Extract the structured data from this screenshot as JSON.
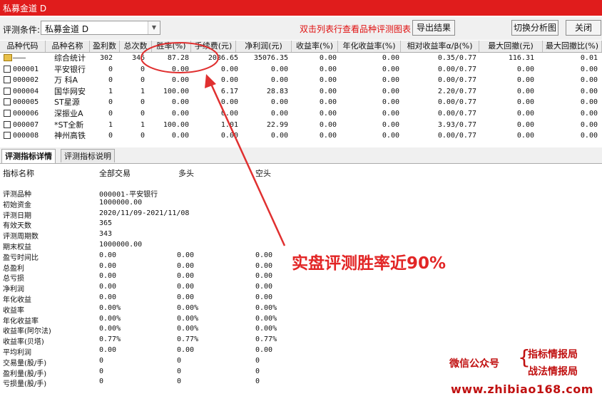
{
  "window": {
    "title": "私募金道 D"
  },
  "toolbar": {
    "condition_label": "评测条件:",
    "condition_value": "私募金道 D",
    "hint": "双击列表行查看品种评测图表",
    "export_label": "导出结果",
    "switch_label": "切换分析图",
    "close_label": "关闭"
  },
  "grid": {
    "columns": [
      "品种代码",
      "品种名称",
      "盈利数",
      "总次数",
      "胜率(%)",
      "手续费(元)",
      "净利润(元)",
      "收益率(%)",
      "年化收益率(%)",
      "相对收益率α/β(%)",
      "最大回撤(元)",
      "最大回撤比(%)"
    ],
    "rows": [
      {
        "code": "———",
        "name": "综合统计",
        "win": "302",
        "total": "346",
        "rate": "87.28",
        "fee": "2086.65",
        "net": "35076.35",
        "ret": "0.00",
        "annual": "0.00",
        "rel": "0.35/0.77",
        "dd": "116.31",
        "ddr": "0.01"
      },
      {
        "code": "000001",
        "name": "平安银行",
        "win": "0",
        "total": "0",
        "rate": "0.00",
        "fee": "0.00",
        "net": "0.00",
        "ret": "0.00",
        "annual": "0.00",
        "rel": "0.00/0.77",
        "dd": "0.00",
        "ddr": "0.00"
      },
      {
        "code": "000002",
        "name": "万 科A",
        "win": "0",
        "total": "0",
        "rate": "0.00",
        "fee": "0.00",
        "net": "0.00",
        "ret": "0.00",
        "annual": "0.00",
        "rel": "0.00/0.77",
        "dd": "0.00",
        "ddr": "0.00"
      },
      {
        "code": "000004",
        "name": "国华网安",
        "win": "1",
        "total": "1",
        "rate": "100.00",
        "fee": "6.17",
        "net": "28.83",
        "ret": "0.00",
        "annual": "0.00",
        "rel": "2.20/0.77",
        "dd": "0.00",
        "ddr": "0.00"
      },
      {
        "code": "000005",
        "name": "ST星源",
        "win": "0",
        "total": "0",
        "rate": "0.00",
        "fee": "0.00",
        "net": "0.00",
        "ret": "0.00",
        "annual": "0.00",
        "rel": "0.00/0.77",
        "dd": "0.00",
        "ddr": "0.00"
      },
      {
        "code": "000006",
        "name": "深振业A",
        "win": "0",
        "total": "0",
        "rate": "0.00",
        "fee": "0.00",
        "net": "0.00",
        "ret": "0.00",
        "annual": "0.00",
        "rel": "0.00/0.77",
        "dd": "0.00",
        "ddr": "0.00"
      },
      {
        "code": "000007",
        "name": "*ST全新",
        "win": "1",
        "total": "1",
        "rate": "100.00",
        "fee": "1.01",
        "net": "22.99",
        "ret": "0.00",
        "annual": "0.00",
        "rel": "3.93/0.77",
        "dd": "0.00",
        "ddr": "0.00"
      },
      {
        "code": "000008",
        "name": "神州高铁",
        "win": "0",
        "total": "0",
        "rate": "0.00",
        "fee": "0.00",
        "net": "0.00",
        "ret": "0.00",
        "annual": "0.00",
        "rel": "0.00/0.77",
        "dd": "0.00",
        "ddr": "0.00"
      }
    ]
  },
  "tabs": {
    "details": "评测指标详情",
    "explain": "评测指标说明"
  },
  "detail": {
    "headers": {
      "name": "指标名称",
      "all": "全部交易",
      "long": "多头",
      "short": "空头"
    },
    "rows": [
      {
        "label": "评测品种",
        "all": "000001-平安银行",
        "long": "",
        "short": ""
      },
      {
        "label": "初始资金",
        "all": "1000000.00",
        "long": "",
        "short": ""
      },
      {
        "label": "评测日期",
        "all": "2020/11/09-2021/11/08",
        "long": "",
        "short": ""
      },
      {
        "label": "有效天数",
        "all": "365",
        "long": "",
        "short": ""
      },
      {
        "label": "评测周期数",
        "all": "343",
        "long": "",
        "short": ""
      },
      {
        "label": "期末权益",
        "all": "1000000.00",
        "long": "",
        "short": ""
      },
      {
        "label": "盈亏时间比",
        "all": "0.00",
        "long": "0.00",
        "short": "0.00"
      },
      {
        "label": "总盈利",
        "all": "0.00",
        "long": "0.00",
        "short": "0.00"
      },
      {
        "label": "总亏损",
        "all": "0.00",
        "long": "0.00",
        "short": "0.00"
      },
      {
        "label": "净利润",
        "all": "0.00",
        "long": "0.00",
        "short": "0.00"
      },
      {
        "label": "年化收益",
        "all": "0.00",
        "long": "0.00",
        "short": "0.00"
      },
      {
        "label": "收益率",
        "all": "0.00%",
        "long": "0.00%",
        "short": "0.00%"
      },
      {
        "label": "年化收益率",
        "all": "0.00%",
        "long": "0.00%",
        "short": "0.00%"
      },
      {
        "label": "收益率(阿尔法)",
        "all": "0.00%",
        "long": "0.00%",
        "short": "0.00%"
      },
      {
        "label": "收益率(贝塔)",
        "all": "0.77%",
        "long": "0.77%",
        "short": "0.77%"
      },
      {
        "label": "平均利润",
        "all": "0.00",
        "long": "0.00",
        "short": "0.00"
      },
      {
        "label": "交易量(股/手)",
        "all": "0",
        "long": "0",
        "short": "0"
      },
      {
        "label": "盈利量(股/手)",
        "all": "0",
        "long": "0",
        "short": "0"
      },
      {
        "label": "亏损量(股/手)",
        "all": "0",
        "long": "0",
        "short": "0"
      }
    ]
  },
  "annotation": {
    "text": "实盘评测胜率近90%",
    "color": "#e22525"
  },
  "watermark": {
    "label": "微信公众号",
    "brace": "{",
    "line1": "指标情报局",
    "line2": "战法情报局",
    "url": "www.zhibiao168.com"
  }
}
